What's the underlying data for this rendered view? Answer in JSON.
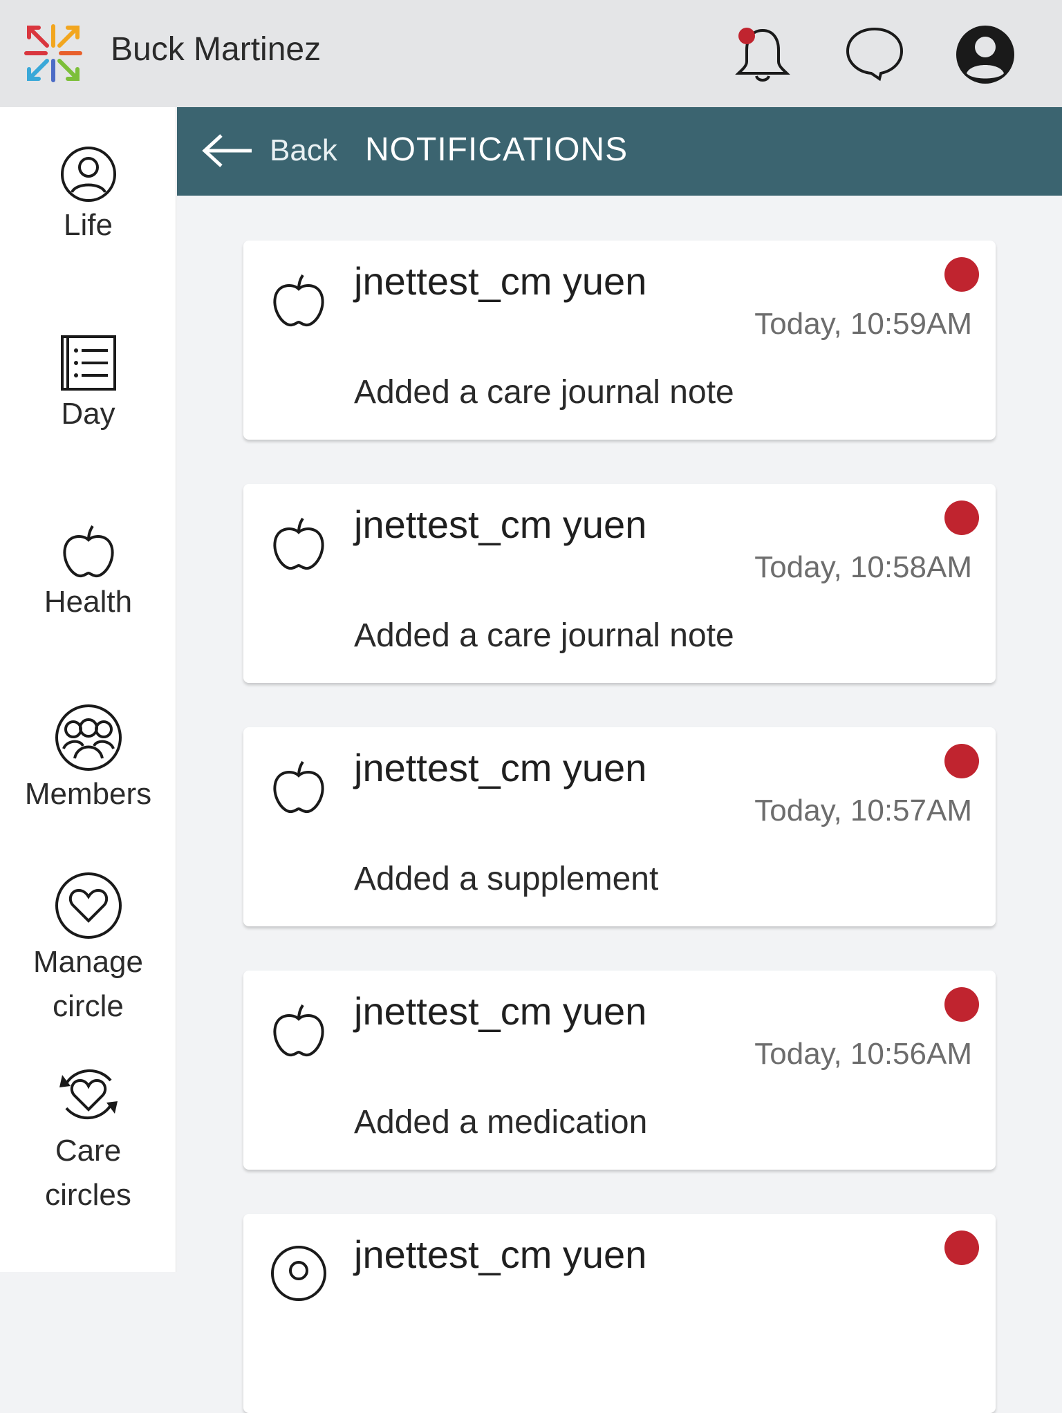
{
  "app": {
    "user_name": "Buck Martinez"
  },
  "colors": {
    "accent_teal": "#3b6470",
    "unread_red": "#c0242f",
    "bell_dot_red": "#c0242f"
  },
  "topbar": {
    "icons": [
      "bell-icon",
      "chat-bubble-icon",
      "profile-icon"
    ]
  },
  "sidebar": {
    "items": [
      {
        "label": "Life",
        "icon": "person-circle-icon"
      },
      {
        "label": "Day",
        "icon": "journal-list-icon"
      },
      {
        "label": "Health",
        "icon": "apple-icon"
      },
      {
        "label": "Members",
        "icon": "members-group-icon"
      },
      {
        "label": "Manage circle",
        "icon": "heart-circle-icon"
      },
      {
        "label": "Care circles",
        "icon": "heart-cycle-icon"
      }
    ]
  },
  "header": {
    "back_label": "Back",
    "title": "NOTIFICATIONS"
  },
  "notifications": [
    {
      "name": "jnettest_cm yuen",
      "time": "Today, 10:59AM",
      "text": "Added a care journal note",
      "icon": "apple-icon",
      "unread": true
    },
    {
      "name": "jnettest_cm yuen",
      "time": "Today, 10:58AM",
      "text": "Added a care journal note",
      "icon": "apple-icon",
      "unread": true
    },
    {
      "name": "jnettest_cm yuen",
      "time": "Today, 10:57AM",
      "text": "Added a supplement",
      "icon": "apple-icon",
      "unread": true
    },
    {
      "name": "jnettest_cm yuen",
      "time": "Today, 10:56AM",
      "text": "Added a medication",
      "icon": "apple-icon",
      "unread": true
    },
    {
      "name": "jnettest_cm yuen",
      "time": "",
      "text": "",
      "icon": "person-circle-icon",
      "unread": true
    }
  ]
}
